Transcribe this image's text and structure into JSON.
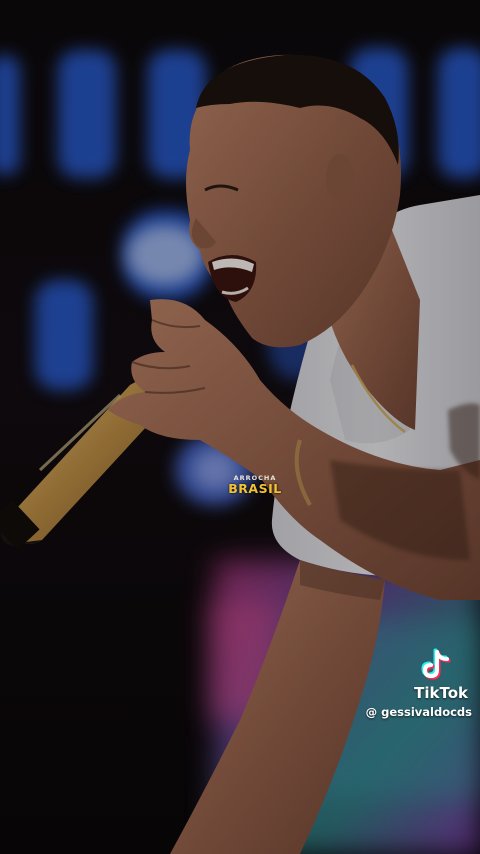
{
  "watermark": {
    "small": "ARROCHA",
    "big": "BRASIL",
    "colors": {
      "small": "#e8e3d8",
      "big": "#f2c230"
    }
  },
  "tiktok": {
    "icon": "tiktok-note-icon",
    "name": "TikTok",
    "handle": "@ gessivaldocds",
    "colors": {
      "cyan": "#25f4ee",
      "red": "#fe2c55",
      "white": "#ffffff"
    }
  }
}
